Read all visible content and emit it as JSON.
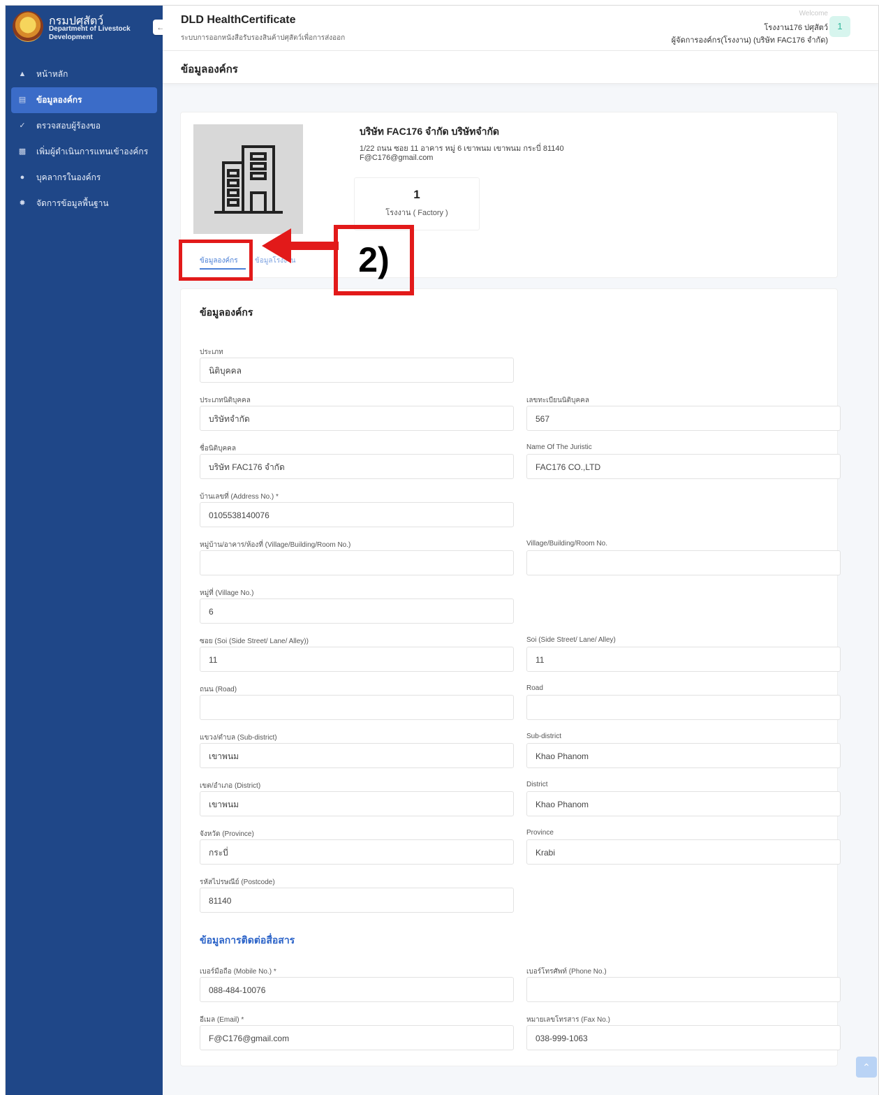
{
  "brand": {
    "title": "กรมปศุสัตว์",
    "subtitle": "Department of Livestock Development"
  },
  "sidebar": {
    "items": [
      {
        "label": "หน้าหลัก",
        "icon": "graduation-icon"
      },
      {
        "label": "ข้อมูลองค์กร",
        "icon": "bank-icon"
      },
      {
        "label": "ตรวจสอบผู้ร้องขอ",
        "icon": "check-icon"
      },
      {
        "label": "เพิ่มผู้ดำเนินการแทนเข้าองค์กร",
        "icon": "user-add-icon"
      },
      {
        "label": "บุคลากรในองค์กร",
        "icon": "users-icon"
      },
      {
        "label": "จัดการข้อมูลพื้นฐาน",
        "icon": "gear-icon"
      }
    ]
  },
  "header": {
    "app_title": "DLD HealthCertificate",
    "app_subtitle": "ระบบการออกหนังสือรับรองสินค้าปศุสัตว์เพื่อการส่งออก",
    "welcome": "Welcome",
    "user_name": "โรงงาน176 ปศุสัตว์",
    "user_role": "ผู้จัดการองค์กร(โรงงาน) (บริษัท FAC176 จำกัด)",
    "avatar": "1"
  },
  "page_title": "ข้อมูลองค์กร",
  "org": {
    "name": "บริษัท FAC176 จำกัด บริษัทจำกัด",
    "address": "1/22 ถนน ซอย 11 อาคาร หมู่ 6 เขาพนม เขาพนม กระบี่ 81140",
    "email": "F@C176@gmail.com",
    "stat_value": "1",
    "stat_label": "โรงงาน ( Factory )",
    "tabs": [
      "ข้อมูลองค์กร",
      "ข้อมูลโรงงาน"
    ]
  },
  "annotation": {
    "label": "2)"
  },
  "form": {
    "section1": "ข้อมูลองค์กร",
    "section2": "ข้อมูลการติดต่อสื่อสาร",
    "fields": {
      "type": {
        "label": "ประเภท",
        "value": "นิติบุคคล"
      },
      "juristic_type": {
        "label": "ประเภทนิติบุคคล",
        "value": "บริษัทจำกัด"
      },
      "juristic_id": {
        "label": "เลขทะเบียนนิติบุคคล",
        "value": "567"
      },
      "juristic_name_th": {
        "label": "ชื่อนิติบุคคล",
        "value": "บริษัท FAC176 จำกัด"
      },
      "juristic_name_en": {
        "label": "Name Of The Juristic",
        "value": "FAC176 CO.,LTD"
      },
      "address_no": {
        "label": "บ้านเลขที่ (Address No.) *",
        "value": "0105538140076"
      },
      "village_th": {
        "label": "หมู่บ้าน/อาคาร/ห้องที่ (Village/Building/Room No.)",
        "value": ""
      },
      "village_en": {
        "label": "Village/Building/Room No.",
        "value": ""
      },
      "moo": {
        "label": "หมู่ที่ (Village No.)",
        "value": "6"
      },
      "soi_th": {
        "label": "ซอย (Soi (Side Street/ Lane/ Alley))",
        "value": "11"
      },
      "soi_en": {
        "label": "Soi (Side Street/ Lane/ Alley)",
        "value": "11"
      },
      "road_th": {
        "label": "ถนน (Road)",
        "value": ""
      },
      "road_en": {
        "label": "Road",
        "value": ""
      },
      "subdistrict_th": {
        "label": "แขวง/ตำบล (Sub-district)",
        "value": "เขาพนม"
      },
      "subdistrict_en": {
        "label": "Sub-district",
        "value": "Khao Phanom"
      },
      "district_th": {
        "label": "เขต/อำเภอ (District)",
        "value": "เขาพนม"
      },
      "district_en": {
        "label": "District",
        "value": "Khao Phanom"
      },
      "province_th": {
        "label": "จังหวัด (Province)",
        "value": "กระบี่"
      },
      "province_en": {
        "label": "Province",
        "value": "Krabi"
      },
      "postcode": {
        "label": "รหัสไปรษณีย์ (Postcode)",
        "value": "81140"
      },
      "mobile": {
        "label": "เบอร์มือถือ (Mobile No.) *",
        "value": "088-484-10076"
      },
      "phone": {
        "label": "เบอร์โทรศัพท์ (Phone No.)",
        "value": ""
      },
      "email": {
        "label": "อีเมล (Email) *",
        "value": "F@C176@gmail.com"
      },
      "fax": {
        "label": "หมายเลขโทรสาร (Fax No.)",
        "value": "038-999-1063"
      }
    }
  },
  "colors": {
    "sidebar": "#1f4788",
    "active": "#3b6cc8",
    "accent": "#2b63c8",
    "annotation": "#e21a1a"
  }
}
